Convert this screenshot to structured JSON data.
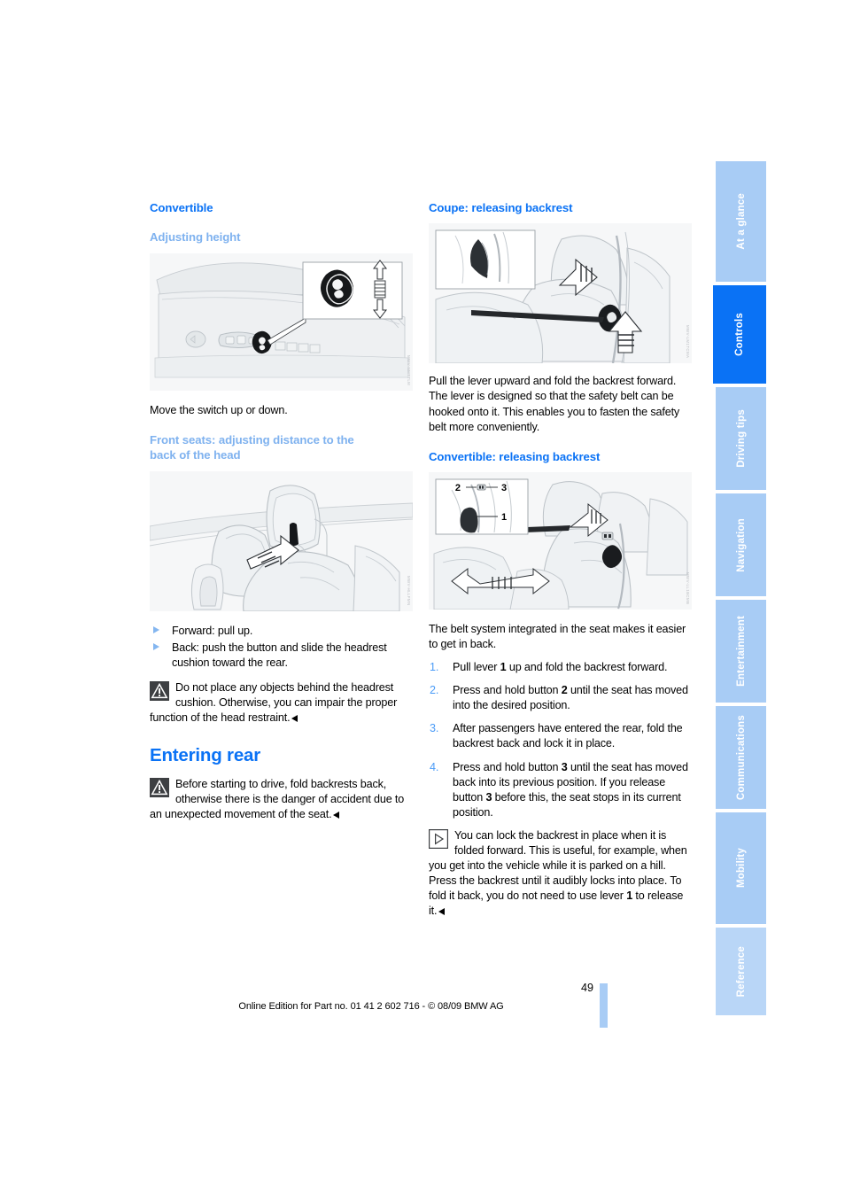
{
  "document": {
    "page_number": "49",
    "footer": "Online Edition for Part no. 01 41 2 602 716 - © 08/09 BMW AG"
  },
  "side_tabs": [
    {
      "label": "At a glance",
      "active": false,
      "style": "normal"
    },
    {
      "label": "Controls",
      "active": true,
      "style": "active"
    },
    {
      "label": "Driving tips",
      "active": false,
      "style": "normal"
    },
    {
      "label": "Navigation",
      "active": false,
      "style": "normal"
    },
    {
      "label": "Entertainment",
      "active": false,
      "style": "normal"
    },
    {
      "label": "Communications",
      "active": false,
      "style": "normal"
    },
    {
      "label": "Mobility",
      "active": false,
      "style": "normal"
    },
    {
      "label": "Reference",
      "active": false,
      "style": "pale"
    }
  ],
  "left_column": {
    "heading": "Convertible",
    "subheading": "Adjusting height",
    "figure_1_code": "MWV-NMTTLM",
    "caption_1": "Move the switch up or down.",
    "heading_2_line1": "Front seats: adjusting distance to the",
    "heading_2_line2": "back of the head",
    "figure_2_code": "MWV-HLLFMN",
    "bullets": [
      "Forward: pull up.",
      "Back: push the button and slide the headrest cushion toward the rear."
    ],
    "warning_1": "Do not place any objects behind the headrest cushion. Otherwise, you can impair the proper function of the head restraint.",
    "title": "Entering rear",
    "warning_2": "Before starting to drive, fold backrests back, otherwise there is the danger of accident due to an unexpected movement of the seat."
  },
  "right_column": {
    "heading_1": "Coupe: releasing backrest",
    "figure_3_code": "MWV-LM1TCMA",
    "paragraph_1": "Pull the lever upward and fold the backrest forward.",
    "paragraph_2": "The lever is designed so that the safety belt can be hooked onto it. This enables you to fasten the safety belt more conveniently.",
    "heading_2": "Convertible: releasing backrest",
    "figure_4_code": "MWV-LL1BCMB",
    "figure_4_callouts": [
      "1",
      "2",
      "3"
    ],
    "intro": "The belt system integrated in the seat makes it easier to get in back.",
    "steps": [
      {
        "num": "1.",
        "parts": [
          {
            "t": "Pull lever ",
            "b": false
          },
          {
            "t": "1",
            "b": true
          },
          {
            "t": " up and fold the backrest forward.",
            "b": false
          }
        ]
      },
      {
        "num": "2.",
        "parts": [
          {
            "t": "Press and hold button ",
            "b": false
          },
          {
            "t": "2",
            "b": true
          },
          {
            "t": " until the seat has moved into the desired position.",
            "b": false
          }
        ]
      },
      {
        "num": "3.",
        "parts": [
          {
            "t": "After passengers have entered the rear, fold the backrest back and lock it in place.",
            "b": false
          }
        ]
      },
      {
        "num": "4.",
        "parts": [
          {
            "t": "Press and hold button ",
            "b": false
          },
          {
            "t": "3",
            "b": true
          },
          {
            "t": " until the seat has moved back into its previous position. If you release button ",
            "b": false
          },
          {
            "t": "3",
            "b": true
          },
          {
            "t": " before this, the seat stops in its current position.",
            "b": false
          }
        ]
      }
    ],
    "note_parts": [
      {
        "t": "You can lock the backrest in place when it is folded forward. This is useful, for example, when you get into the vehicle while it is parked on a hill. Press the backrest until it audibly locks into place. To fold it back, you do not need to use lever ",
        "b": false
      },
      {
        "t": "1",
        "b": true
      },
      {
        "t": " to release it.",
        "b": false
      }
    ]
  },
  "colors": {
    "heading_blue": "#0a72f5",
    "subheading_blue": "#7fb2ef",
    "tab_blue": "#a8ccf5",
    "tab_pale": "#b9d6f7",
    "number_blue": "#4a9bf7"
  }
}
